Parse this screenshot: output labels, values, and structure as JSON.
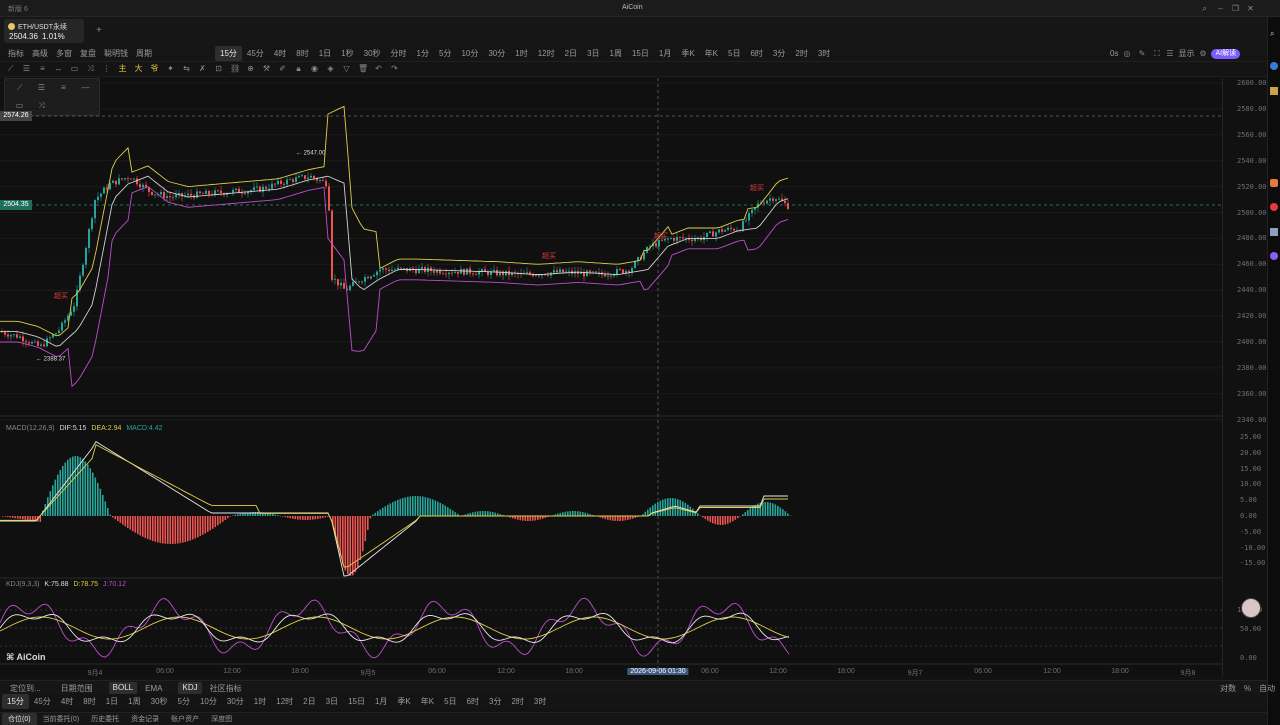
{
  "window": {
    "title": "AiCoin",
    "left_title": "新版 6"
  },
  "symbol": {
    "name": "ETH/USDT永续",
    "price": "2504.36",
    "change": "1.01%",
    "add": "+"
  },
  "toolbar": {
    "left": [
      "指标",
      "高级",
      "多窗",
      "复盘",
      "聪明钱",
      "周期"
    ],
    "periods": [
      "15分",
      "45分",
      "4时",
      "8时",
      "1日",
      "1秒",
      "30秒",
      "分时",
      "1分",
      "5分",
      "10分",
      "30分",
      "1时",
      "12时",
      "2日",
      "3日",
      "1周",
      "15日",
      "1月",
      "季K",
      "年K",
      "5日",
      "6时",
      "3分",
      "2时",
      "3时"
    ],
    "active_period": "15分",
    "right": [
      "0s",
      "显示",
      "AI解读"
    ]
  },
  "chart": {
    "y_ticks": [
      "2600.00",
      "2580.00",
      "2560.00",
      "2540.00",
      "2520.00",
      "2500.00",
      "2480.00",
      "2460.00",
      "2440.00",
      "2420.00",
      "2400.00",
      "2380.00",
      "2360.00",
      "2340.00"
    ],
    "high_label": "2547.00",
    "low_label": "2388.37",
    "current_price": "2504.35",
    "crosshair_price": "2574.26",
    "signals": [
      "超买",
      "超买",
      "超买",
      "超买"
    ]
  },
  "macd": {
    "label": "MACD(12,26,9)",
    "dif": "DIF:5.15",
    "dea": "DEA:2.94",
    "macd": "MACD:4.42",
    "ticks": [
      "25.00",
      "20.00",
      "15.00",
      "10.00",
      "5.00",
      "0.00",
      "-5.00",
      "-10.00",
      "-15.00"
    ]
  },
  "kdj": {
    "label": "KDJ(9,3,3)",
    "k": "K:75.88",
    "d": "D:78.75",
    "j": "J:70.12",
    "ticks": [
      "100.00",
      "50.00",
      "0.00"
    ]
  },
  "x_axis": {
    "labels": [
      "9月4",
      "06:00",
      "12:00",
      "18:00",
      "9月5",
      "06:00",
      "12:00",
      "18:00",
      "06:00",
      "12:00",
      "18:00",
      "9月7",
      "06:00",
      "12:00",
      "18:00",
      "9月8"
    ],
    "crosshair": "2026-09-06 01:30"
  },
  "brand": "AiCoin",
  "bottom_tabs": {
    "left": [
      "定位到...",
      "日期范围"
    ],
    "inds": [
      "BOLL",
      "EMA",
      "KDJ",
      "社区指标"
    ],
    "right": [
      "对数",
      "%",
      "自动"
    ]
  },
  "period_row": [
    "15分",
    "45分",
    "4时",
    "8时",
    "1日",
    "1周",
    "30秒",
    "5分",
    "10分",
    "30分",
    "1时",
    "12时",
    "2日",
    "3日",
    "15日",
    "1月",
    "季K",
    "年K",
    "5日",
    "6时",
    "3分",
    "2时",
    "3时"
  ],
  "trade_tabs": [
    "仓位(0)",
    "当前委托(0)",
    "历史委托",
    "资金记录",
    "账户资产",
    "深度图"
  ],
  "colors": {
    "up": "#26a69a",
    "down": "#ef5350",
    "upper": "#e0d04a",
    "mid": "#d0d0d0",
    "lower": "#c04dd0",
    "accent": "#7b5cff"
  }
}
